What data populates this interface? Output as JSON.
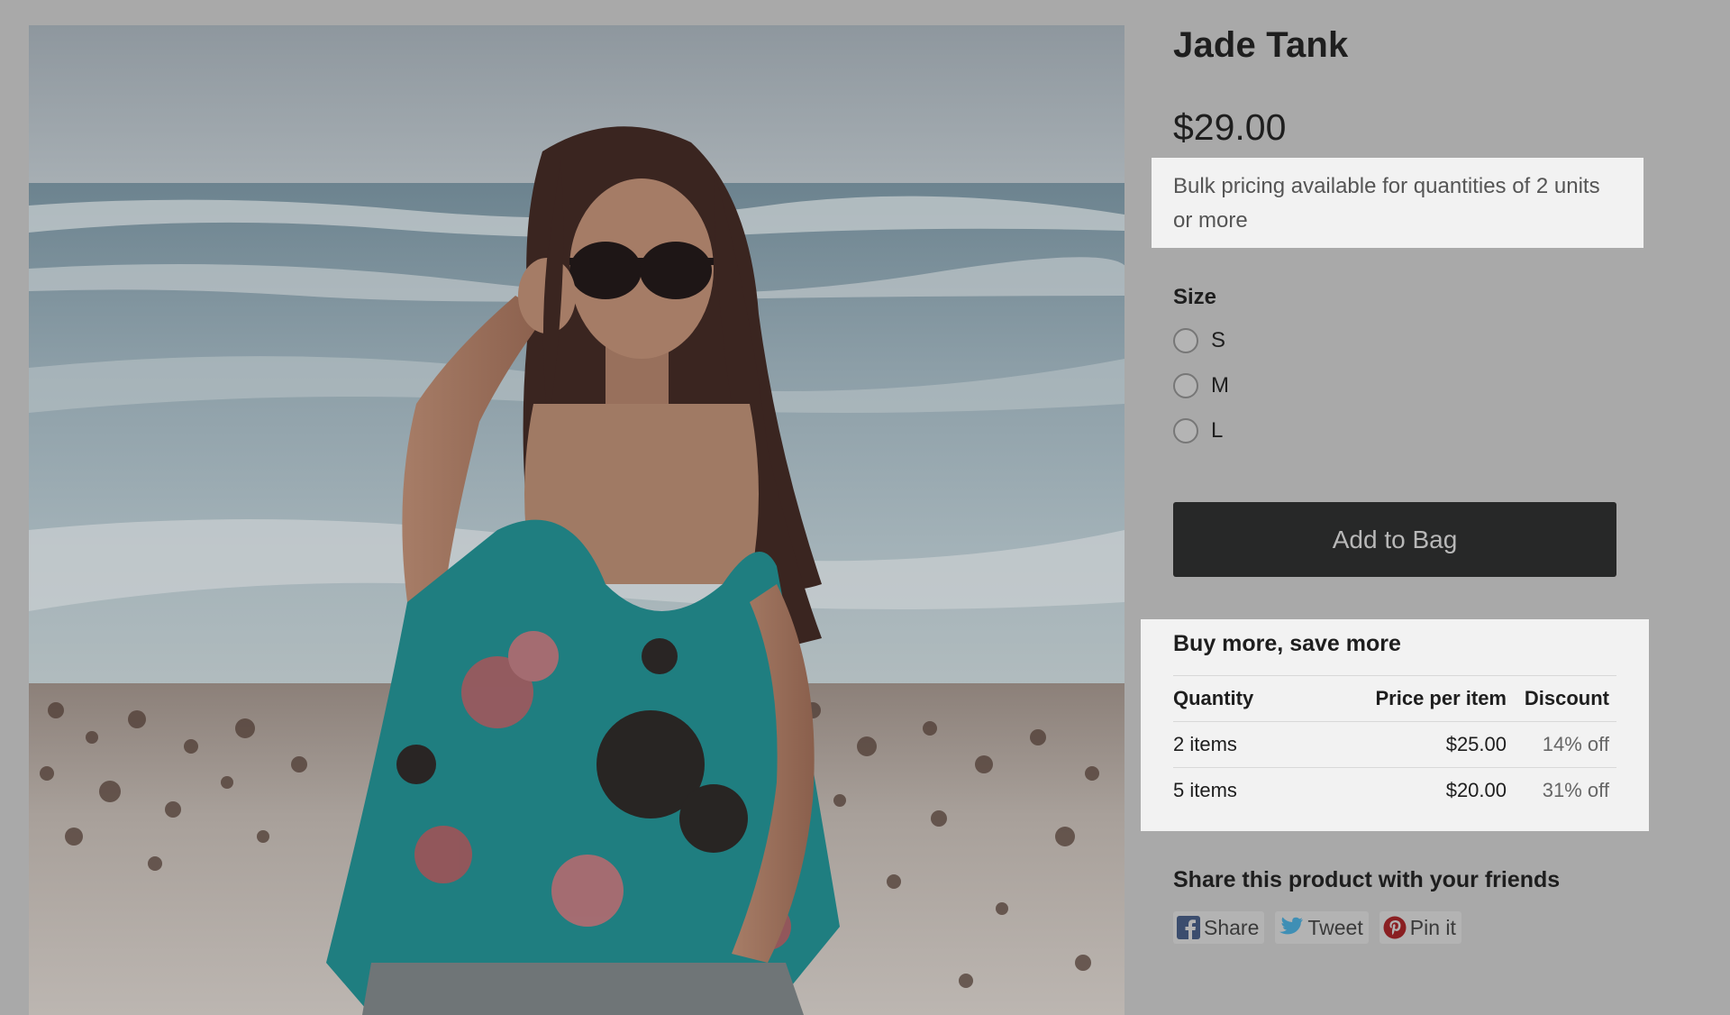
{
  "product": {
    "title": "Jade Tank",
    "price": "$29.00",
    "bulk_note": "Bulk pricing available for quantities of 2 units or more"
  },
  "size": {
    "label": "Size",
    "options": [
      "S",
      "M",
      "L"
    ]
  },
  "add_to_bag": "Add to Bag",
  "bulk_table": {
    "title": "Buy more, save more",
    "headers": {
      "quantity": "Quantity",
      "price": "Price per item",
      "discount": "Discount"
    },
    "rows": [
      {
        "quantity": "2 items",
        "price": "$25.00",
        "discount": "14% off"
      },
      {
        "quantity": "5 items",
        "price": "$20.00",
        "discount": "31% off"
      }
    ]
  },
  "share": {
    "heading": "Share this product with your friends",
    "buttons": [
      {
        "label": "Share",
        "icon": "facebook-icon"
      },
      {
        "label": "Tweet",
        "icon": "twitter-icon"
      },
      {
        "label": "Pin it",
        "icon": "pinterest-icon"
      }
    ]
  },
  "colors": {
    "overlay": "#a9a9a9",
    "button": "#272828",
    "highlight": "#f2f2f2",
    "facebook": "#3b4d6e",
    "twitter": "#3f8fb5",
    "pinterest": "#8a1f22"
  }
}
